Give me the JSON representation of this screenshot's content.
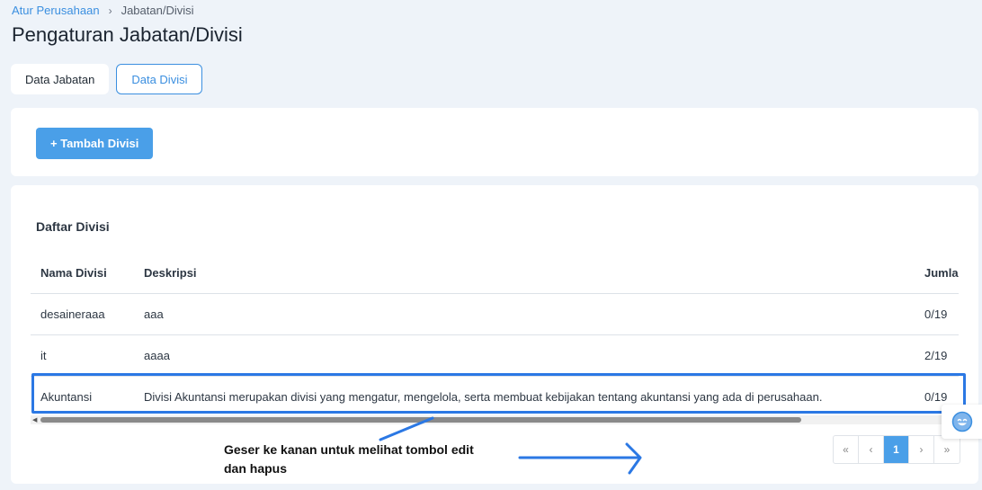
{
  "breadcrumb": {
    "parent": "Atur Perusahaan",
    "separator": "›",
    "current": "Jabatan/Divisi"
  },
  "page_title": "Pengaturan Jabatan/Divisi",
  "tabs": [
    {
      "label": "Data Jabatan",
      "active": false
    },
    {
      "label": "Data Divisi",
      "active": true
    }
  ],
  "add_button_label": "+ Tambah Divisi",
  "section_title": "Daftar Divisi",
  "table": {
    "headers": [
      "Nama Divisi",
      "Deskripsi",
      "Jumla"
    ],
    "rows": [
      [
        "desaineraaa",
        "aaa",
        "0/19"
      ],
      [
        "it",
        "aaaa",
        "2/19"
      ],
      [
        "Akuntansi",
        "Divisi Akuntansi merupakan divisi yang mengatur, mengelola, serta membuat kebijakan tentang akuntansi yang ada di perusahaan.",
        "0/19"
      ]
    ]
  },
  "annotation": {
    "line1": "Geser ke kanan untuk melihat tombol edit",
    "line2": "dan hapus"
  },
  "pagination": {
    "first": "«",
    "prev": "‹",
    "current": "1",
    "next": "›",
    "last": "»"
  },
  "colors": {
    "accent": "#4a9fe8",
    "highlight": "#2b78e4",
    "background": "#eef3f9"
  },
  "icons": {
    "feedback": "smiley-face-icon"
  }
}
